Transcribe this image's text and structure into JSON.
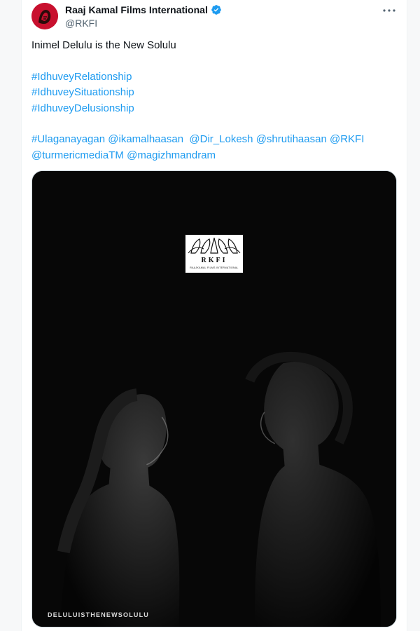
{
  "tweet": {
    "author_name": "Raaj Kamal Films International",
    "handle": "@RKFI",
    "text_line": "Inimel Delulu is the New Solulu",
    "hashtags": [
      "#IdhuveyRelationship",
      "#IdhuveySituationship",
      "#IdhuveyDelusionship"
    ],
    "mentions_line1": [
      "#Ulaganayagan",
      "@ikamalhaasan",
      "@Dir_Lokesh",
      "@shrutihaasan",
      "@RKFI"
    ],
    "mentions_line2": [
      "@turmericmediaTM",
      "@magizhmandram"
    ]
  },
  "media": {
    "logo_text": "RKFI",
    "logo_subtext": "RAAJKAMAL FILMS INTERNATIONAL",
    "caption": "DELULUISTHENEWSOLULU"
  },
  "icons": {
    "verified": "verified-badge-icon",
    "more": "more-options-icon"
  },
  "colors": {
    "link": "#1d9bf0",
    "text": "#0f1419",
    "secondary": "#536471",
    "avatar_bg": "#c8102e"
  }
}
